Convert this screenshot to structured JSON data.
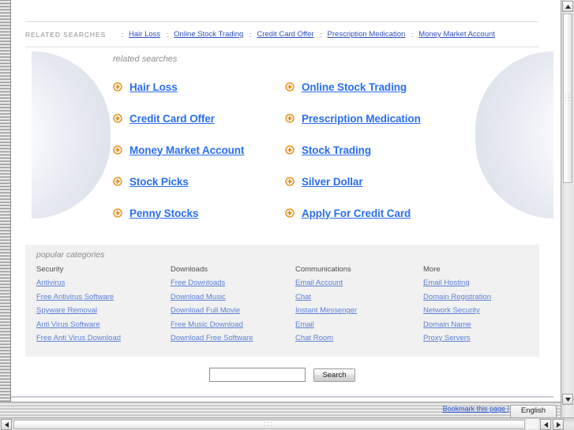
{
  "top_strip": {
    "label": "RELATED SEARCHES",
    "separator": "::",
    "links": [
      "Hair Loss",
      "Online Stock Trading",
      "Credit Card Offer",
      "Prescription Medication",
      "Money Market Account"
    ]
  },
  "related_searches": {
    "title": "related searches",
    "icon": "arrow-circle-right-icon",
    "items": [
      "Hair Loss",
      "Online Stock Trading",
      "Credit Card Offer",
      "Prescription Medication",
      "Money Market Account",
      "Stock Trading",
      "Stock Picks",
      "Silver Dollar",
      "Penny Stocks",
      "Apply For Credit Card"
    ]
  },
  "popular_categories": {
    "title": "popular categories",
    "columns": [
      {
        "heading": "Security",
        "links": [
          "Antivirus",
          "Free Antivirus Software",
          "Spyware Removal",
          "Anti Virus Software",
          "Free Anti Virus Download"
        ]
      },
      {
        "heading": "Downloads",
        "links": [
          "Free Downloads",
          "Download Music",
          "Download Full Movie",
          "Free Music Download",
          "Download Free Software"
        ]
      },
      {
        "heading": "Communications",
        "links": [
          "Email Account",
          "Chat",
          "Instant Messenger",
          "Email",
          "Chat Room"
        ]
      },
      {
        "heading": "More",
        "links": [
          "Email Hosting",
          "Domain Registration",
          "Network Security",
          "Domain Name",
          "Proxy Servers"
        ]
      }
    ]
  },
  "search": {
    "icon": "magnifier-icon",
    "value": "",
    "placeholder": "",
    "button_label": "Search"
  },
  "statusbar": {
    "bookmark_label": "Bookmark this page |",
    "language_value": "English",
    "language_options": [
      "English"
    ]
  },
  "scrollbars": {
    "up_arrow": "▲",
    "down_arrow": "▼",
    "left_arrow": "◀",
    "right_arrow": "▶"
  },
  "colors": {
    "link_blue": "#2a6ef0",
    "small_link_blue": "#2f4fbf",
    "category_link_blue": "#5b7fd6",
    "icon_orange": "#e8890a",
    "panel_gray": "#f1f1f1",
    "muted_text": "#8b8b8b"
  }
}
